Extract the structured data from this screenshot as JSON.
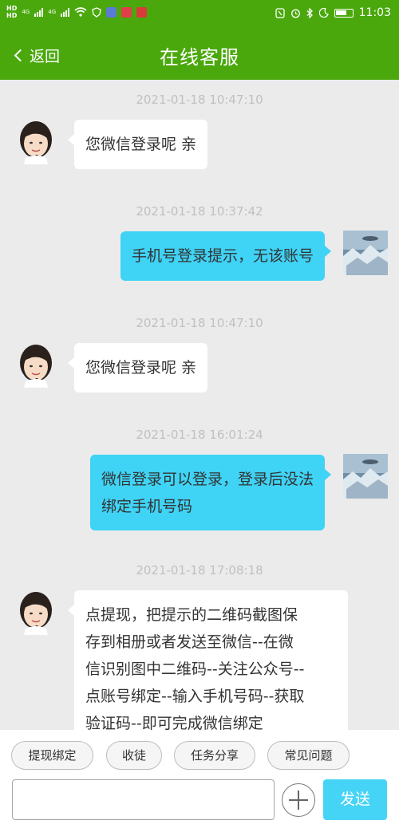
{
  "status_bar": {
    "left_labels": [
      "HD",
      "HD"
    ],
    "network_labels": [
      "4G",
      "4G"
    ],
    "time": "11:03"
  },
  "header": {
    "back_label": "返回",
    "title": "在线客服"
  },
  "messages": [
    {
      "timestamp": "2021-01-18 10:47:10",
      "side": "agent",
      "lines": [
        "您微信登录呢 亲"
      ]
    },
    {
      "timestamp": "2021-01-18 10:37:42",
      "side": "user",
      "lines": [
        "手机号登录提示，无该账号"
      ]
    },
    {
      "timestamp": "2021-01-18 10:47:10",
      "side": "agent",
      "lines": [
        "您微信登录呢 亲"
      ]
    },
    {
      "timestamp": "2021-01-18 16:01:24",
      "side": "user",
      "lines": [
        "微信登录可以登录，登录后没法",
        "绑定手机号码"
      ]
    },
    {
      "timestamp": "2021-01-18 17:08:18",
      "side": "agent",
      "lines": [
        "点提现，把提示的二维码截图保",
        "存到相册或者发送至微信--在微",
        "信识别图中二维码--关注公众号--",
        "点账号绑定--输入手机号码--获取",
        "验证码--即可完成微信绑定"
      ]
    }
  ],
  "quick_replies": [
    "提现绑定",
    "收徒",
    "任务分享",
    "常见问题"
  ],
  "composer": {
    "input_value": "",
    "send_label": "发送"
  },
  "colors": {
    "header_bg": "#4aa80c",
    "user_bubble": "#3fd3f5",
    "send_button": "#46d4f6"
  }
}
